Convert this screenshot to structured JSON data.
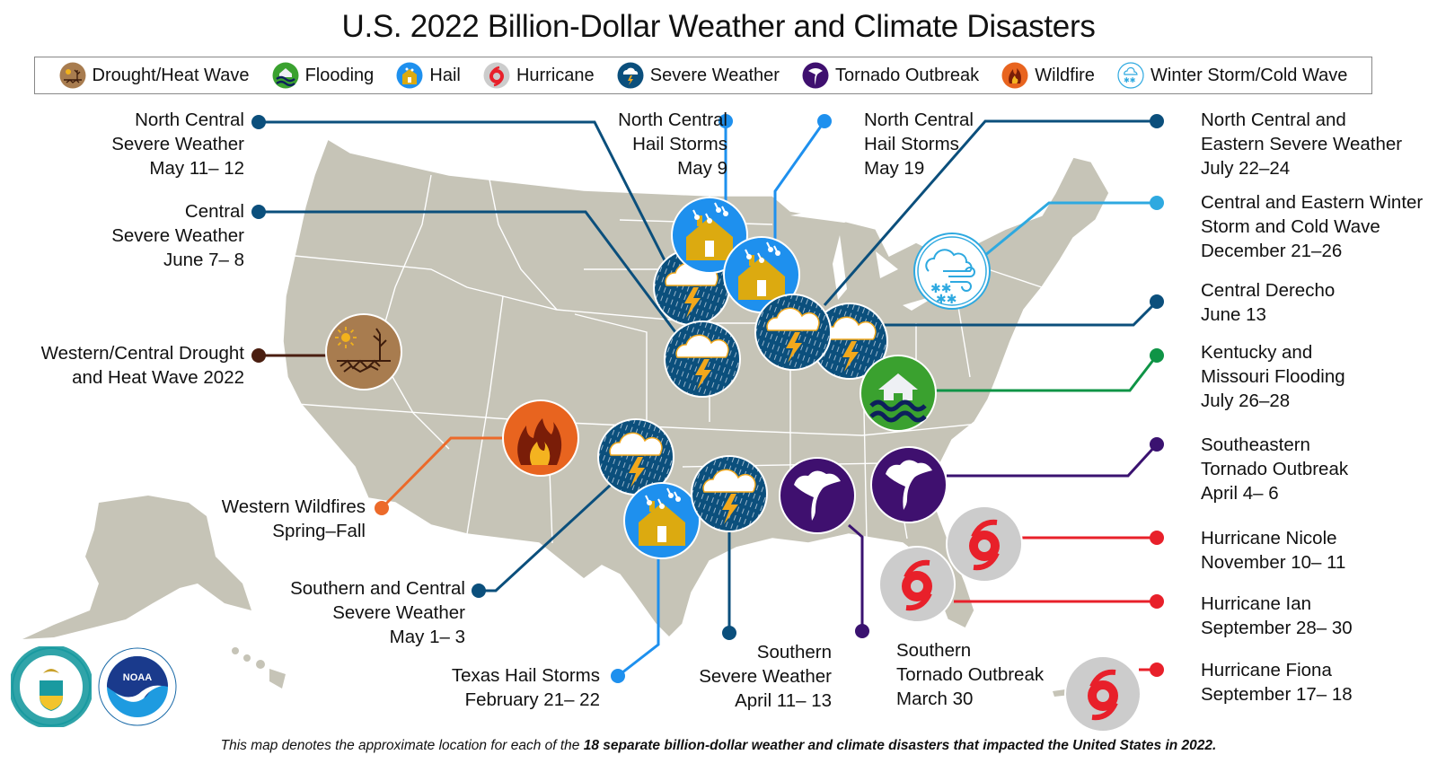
{
  "title": "U.S. 2022 Billion-Dollar Weather and Climate Disasters",
  "legend": [
    {
      "key": "drought",
      "label": "Drought/Heat Wave",
      "color": "#a87c4f"
    },
    {
      "key": "flooding",
      "label": "Flooding",
      "color": "#3aa12f"
    },
    {
      "key": "hail",
      "label": "Hail",
      "color": "#1e90ee"
    },
    {
      "key": "hurricane",
      "label": "Hurricane",
      "color": "#cccccc"
    },
    {
      "key": "severe",
      "label": "Severe Weather",
      "color": "#0b4f7c"
    },
    {
      "key": "tornado",
      "label": "Tornado Outbreak",
      "color": "#3f106f"
    },
    {
      "key": "wildfire",
      "label": "Wildfire",
      "color": "#e8641f"
    },
    {
      "key": "winter",
      "label": "Winter Storm/Cold Wave",
      "color": "#ffffff"
    }
  ],
  "line_colors": {
    "severe": "#0b4f7c",
    "hail": "#1e90ee",
    "drought": "#4a1e10",
    "wildfire": "#ec6a2a",
    "winter": "#2ea9e0",
    "flooding": "#0f9446",
    "tornado": "#3a1270",
    "hurricane": "#e8202a"
  },
  "events": [
    {
      "id": "nc-severe-may",
      "type": "severe",
      "lines": [
        "North Central",
        "Severe Weather",
        "May 11– 12"
      ]
    },
    {
      "id": "central-severe-june",
      "type": "severe",
      "lines": [
        "Central",
        "Severe Weather",
        "June 7– 8"
      ]
    },
    {
      "id": "drought",
      "type": "drought",
      "lines": [
        "Western/Central Drought",
        "and Heat Wave 2022"
      ]
    },
    {
      "id": "wildfires",
      "type": "wildfire",
      "lines": [
        "Western Wildfires",
        "Spring–Fall"
      ]
    },
    {
      "id": "sc-severe-may",
      "type": "severe",
      "lines": [
        "Southern and Central",
        "Severe Weather",
        "May 1– 3"
      ]
    },
    {
      "id": "tx-hail",
      "type": "hail",
      "lines": [
        "Texas Hail Storms",
        "February 21– 22"
      ]
    },
    {
      "id": "south-severe-april",
      "type": "severe",
      "lines": [
        "Southern",
        "Severe Weather",
        "April 11– 13"
      ]
    },
    {
      "id": "south-tornado",
      "type": "tornado",
      "lines": [
        "Southern",
        "Tornado Outbreak",
        "March 30"
      ]
    },
    {
      "id": "nc-hail-may9",
      "type": "hail",
      "lines": [
        "North Central",
        "Hail Storms",
        "May 9"
      ]
    },
    {
      "id": "nc-hail-may19",
      "type": "hail",
      "lines": [
        "North Central",
        "Hail Storms",
        "May 19"
      ]
    },
    {
      "id": "nce-severe-july",
      "type": "severe",
      "lines": [
        "North Central and",
        "Eastern Severe Weather",
        "July 22–24"
      ]
    },
    {
      "id": "winter-dec",
      "type": "winter",
      "lines": [
        "Central and Eastern Winter",
        "Storm and Cold Wave",
        "December 21–26"
      ]
    },
    {
      "id": "derecho",
      "type": "severe",
      "lines": [
        "Central Derecho",
        "June 13"
      ]
    },
    {
      "id": "ky-mo-flood",
      "type": "flooding",
      "lines": [
        "Kentucky and",
        "Missouri Flooding",
        "July 26–28"
      ]
    },
    {
      "id": "se-tornado",
      "type": "tornado",
      "lines": [
        "Southeastern",
        "Tornado Outbreak",
        "April 4– 6"
      ]
    },
    {
      "id": "nicole",
      "type": "hurricane",
      "lines": [
        "Hurricane Nicole",
        "November 10– 11"
      ]
    },
    {
      "id": "ian",
      "type": "hurricane",
      "lines": [
        "Hurricane Ian",
        "September 28– 30"
      ]
    },
    {
      "id": "fiona",
      "type": "hurricane",
      "lines": [
        "Hurricane Fiona",
        "September 17– 18"
      ]
    }
  ],
  "footer": {
    "prefix": "This map denotes the approximate location for each of the ",
    "bold": "18 separate billion-dollar weather and climate disasters that impacted the United States in 2022."
  },
  "logos": {
    "doc_seal": "Department of Commerce seal",
    "noaa": "NOAA"
  },
  "colors": {
    "land": "#c6c4b7",
    "border": "#ffffff"
  }
}
